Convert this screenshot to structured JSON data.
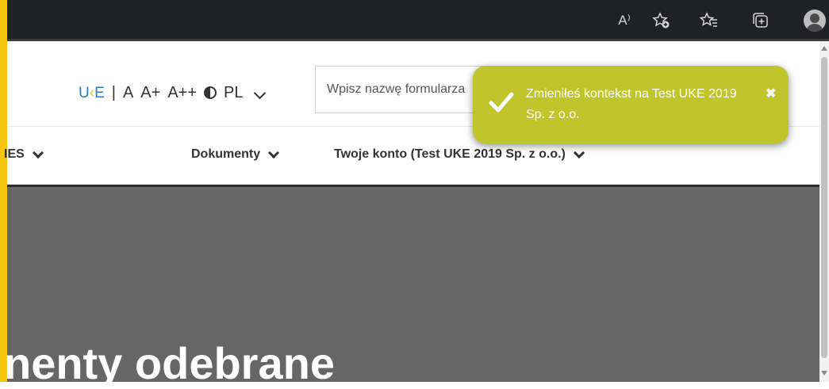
{
  "browser": {
    "icons": [
      "read-aloud-icon",
      "add-favorite-icon",
      "favorites-icon",
      "collections-icon",
      "profile-icon"
    ],
    "read_aloud_label": "A⁾"
  },
  "header": {
    "logo": {
      "u": "U",
      "k": "‹",
      "e": "E"
    },
    "separator": "|",
    "font_small": "A",
    "font_medium": "A+",
    "font_large": "A++",
    "language": "PL",
    "search_placeholder": "Wpisz nazwę formularza"
  },
  "nav": {
    "items": [
      {
        "label": "IES"
      },
      {
        "label": "Dokumenty"
      },
      {
        "label": "Twoje konto (Test UKE 2019 Sp. z o.o.)"
      }
    ]
  },
  "hero": {
    "title": "nenty odebrane"
  },
  "toast": {
    "message": "Zmieniłeś kontekst na Test UKE 2019 Sp. z o.o.",
    "close": "✖"
  },
  "colors": {
    "accent_stripe": "#f5c50f",
    "toast_bg": "#bfc52a",
    "hero_bg": "#666666",
    "browser_bg": "#202124",
    "logo_blue": "#2d7bc4",
    "logo_green": "#c9d12a"
  }
}
